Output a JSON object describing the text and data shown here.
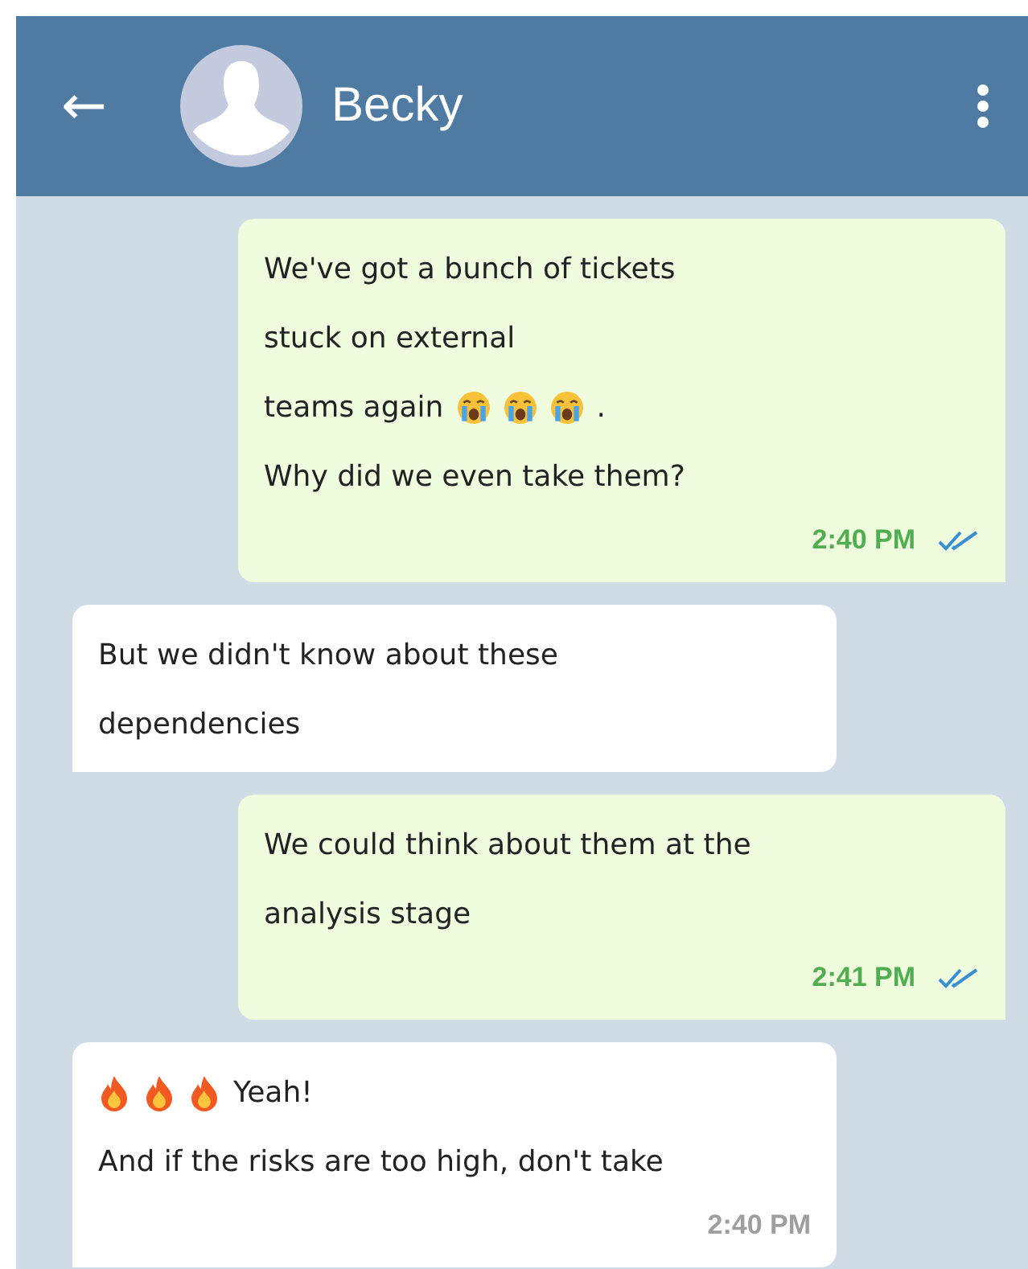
{
  "header": {
    "back_icon": "←",
    "contact_name": "Becky"
  },
  "messages": [
    {
      "outgoing": true,
      "lines": [
        [
          {
            "kind": "text",
            "text": "We've got a bunch of tickets"
          }
        ],
        [
          {
            "kind": "text",
            "text": "stuck on external"
          }
        ],
        [
          {
            "kind": "text",
            "text": "teams again"
          },
          {
            "kind": "crying"
          },
          {
            "kind": "crying"
          },
          {
            "kind": "crying"
          },
          {
            "kind": "text",
            "text": "."
          }
        ],
        [
          {
            "kind": "text",
            "text": "Why did we even take them?"
          }
        ]
      ],
      "time": "2:40 PM",
      "read": true
    },
    {
      "outgoing": false,
      "lines": [
        [
          {
            "kind": "text",
            "text": "But we didn't know about these"
          }
        ],
        [
          {
            "kind": "text",
            "text": "dependencies"
          }
        ]
      ]
    },
    {
      "outgoing": true,
      "lines": [
        [
          {
            "kind": "text",
            "text": "We could think about them at the"
          }
        ],
        [
          {
            "kind": "text",
            "text": "analysis stage"
          }
        ]
      ],
      "time": "2:41 PM",
      "read": true
    },
    {
      "outgoing": false,
      "lines": [
        [
          {
            "kind": "fire"
          },
          {
            "kind": "fire"
          },
          {
            "kind": "fire"
          },
          {
            "kind": "text",
            "text": "Yeah!"
          }
        ],
        [
          {
            "kind": "text",
            "text": "And if the risks are too high, don't take"
          }
        ]
      ],
      "time": "2:40 PM"
    }
  ]
}
